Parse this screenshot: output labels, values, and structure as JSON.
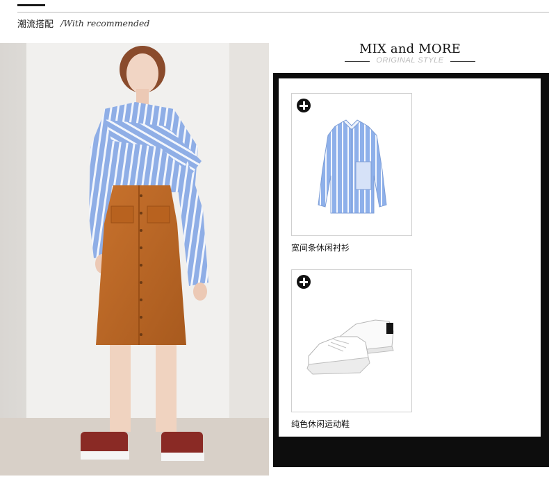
{
  "header": {
    "title_cn": "潮流搭配",
    "title_en": "/With recommended"
  },
  "mix": {
    "title": "MIX and MORE",
    "subtitle": "ORIGINAL STYLE"
  },
  "products": [
    {
      "name": "宽间条休闲衬衫",
      "icon": "plus-icon"
    },
    {
      "name": "纯色休闲运动鞋",
      "icon": "plus-icon"
    }
  ],
  "colors": {
    "shirt_blue": "#8faee6",
    "skirt_orange": "#c06a28",
    "frame": "#0d0d0d"
  }
}
